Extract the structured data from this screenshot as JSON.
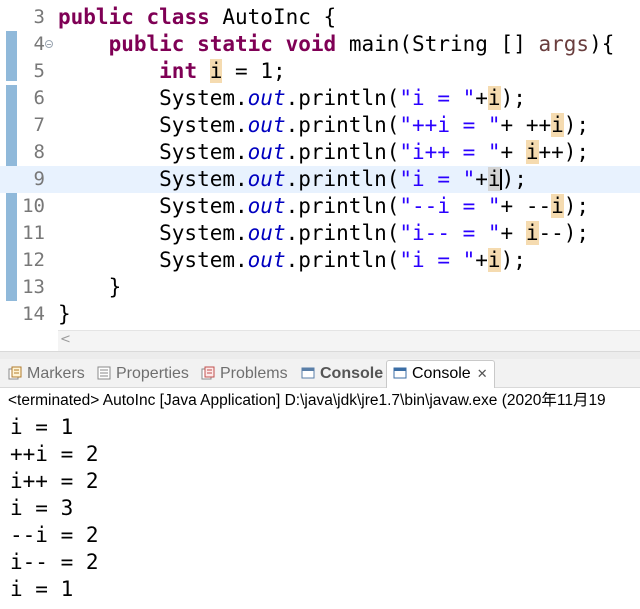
{
  "editor": {
    "current_line": 9,
    "lines": [
      {
        "num": "3",
        "segments": [
          [
            "kw",
            "public"
          ],
          [
            "p",
            " "
          ],
          [
            "kw",
            "class"
          ],
          [
            "p",
            " AutoInc {"
          ]
        ]
      },
      {
        "num": "4",
        "fold": "−",
        "segments": [
          [
            "p",
            "    "
          ],
          [
            "kw",
            "public"
          ],
          [
            "p",
            " "
          ],
          [
            "kw",
            "static"
          ],
          [
            "p",
            " "
          ],
          [
            "kw",
            "void"
          ],
          [
            "p",
            " main(String [] "
          ],
          [
            "var",
            "args"
          ],
          [
            "p",
            "){"
          ]
        ]
      },
      {
        "num": "5",
        "segments": [
          [
            "p",
            "        "
          ],
          [
            "kw",
            "int"
          ],
          [
            "p",
            " "
          ],
          [
            "occ",
            "i"
          ],
          [
            "p",
            " = 1;"
          ]
        ]
      },
      {
        "num": "6",
        "segments": [
          [
            "p",
            "        System."
          ],
          [
            "fi",
            "out"
          ],
          [
            "p",
            ".println("
          ],
          [
            "st",
            "\"i = \""
          ],
          [
            "p",
            "+"
          ],
          [
            "occ",
            "i"
          ],
          [
            "p",
            ");"
          ]
        ]
      },
      {
        "num": "7",
        "segments": [
          [
            "p",
            "        System."
          ],
          [
            "fi",
            "out"
          ],
          [
            "p",
            ".println("
          ],
          [
            "st",
            "\"++i = \""
          ],
          [
            "p",
            "+ ++"
          ],
          [
            "occ",
            "i"
          ],
          [
            "p",
            ");"
          ]
        ]
      },
      {
        "num": "8",
        "segments": [
          [
            "p",
            "        System."
          ],
          [
            "fi",
            "out"
          ],
          [
            "p",
            ".println("
          ],
          [
            "st",
            "\"i++ = \""
          ],
          [
            "p",
            "+ "
          ],
          [
            "occ",
            "i"
          ],
          [
            "p",
            "++);"
          ]
        ]
      },
      {
        "num": "9",
        "segments": [
          [
            "p",
            "        System."
          ],
          [
            "fi",
            "out"
          ],
          [
            "p",
            ".println("
          ],
          [
            "st",
            "\"i = \""
          ],
          [
            "p",
            "+"
          ],
          [
            "occcur",
            "i"
          ],
          [
            "caret",
            ""
          ],
          [
            "p",
            ");"
          ]
        ]
      },
      {
        "num": "10",
        "segments": [
          [
            "p",
            "        System."
          ],
          [
            "fi",
            "out"
          ],
          [
            "p",
            ".println("
          ],
          [
            "st",
            "\"--i = \""
          ],
          [
            "p",
            "+ --"
          ],
          [
            "occ",
            "i"
          ],
          [
            "p",
            ");"
          ]
        ]
      },
      {
        "num": "11",
        "segments": [
          [
            "p",
            "        System."
          ],
          [
            "fi",
            "out"
          ],
          [
            "p",
            ".println("
          ],
          [
            "st",
            "\"i-- = \""
          ],
          [
            "p",
            "+ "
          ],
          [
            "occ",
            "i"
          ],
          [
            "p",
            "--);"
          ]
        ]
      },
      {
        "num": "12",
        "segments": [
          [
            "p",
            "        System."
          ],
          [
            "fi",
            "out"
          ],
          [
            "p",
            ".println("
          ],
          [
            "st",
            "\"i = \""
          ],
          [
            "p",
            "+"
          ],
          [
            "occ",
            "i"
          ],
          [
            "p",
            ");"
          ]
        ]
      },
      {
        "num": "13",
        "segments": [
          [
            "p",
            "    }"
          ]
        ]
      },
      {
        "num": "14",
        "segments": [
          [
            "p",
            "}"
          ]
        ]
      }
    ],
    "scroll_left_arrow": "<"
  },
  "tabs": {
    "markers": "Markers",
    "properties": "Properties",
    "problems": "Problems",
    "console_inactive": "Console",
    "console_active": "Console",
    "close": "✕"
  },
  "console": {
    "header": "<terminated> AutoInc [Java Application] D:\\java\\jdk\\jre1.7\\bin\\javaw.exe (2020年11月19",
    "output": [
      "i = 1",
      "++i = 2",
      "i++ = 2",
      "i = 3",
      "--i = 2",
      "i-- = 2",
      "i = 1"
    ]
  },
  "colors": {
    "keyword": "#7f0055",
    "string": "#2a00ff",
    "static_field": "#0000c0",
    "occurrence_highlight": "#f5dbb0",
    "current_line": "#e8f2fe"
  }
}
